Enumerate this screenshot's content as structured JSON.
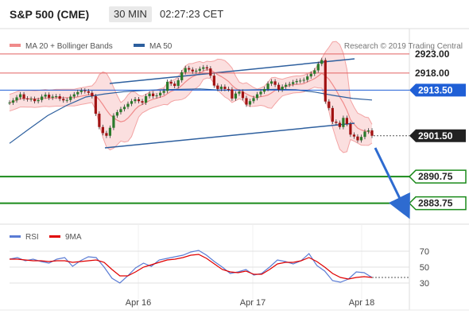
{
  "header": {
    "title": "S&P 500 (CME)",
    "timeframe": "30 MIN",
    "time": "02:27:23 CET"
  },
  "colors": {
    "accent_blue": "#1f5fd6",
    "target_green": "#1a8a1a",
    "resistance_red": "#e26060",
    "ma50": "#2d5f9e",
    "band": "#f3a4a4",
    "rsi": "#5a7bd4",
    "rsi_ma": "#e00000"
  },
  "chart_data": [
    {
      "type": "line",
      "title": "S&P 500 (CME) 30 MIN",
      "legend": [
        {
          "name": "MA 20 + Bollinger Bands"
        },
        {
          "name": "MA 50"
        }
      ],
      "watermark": "Research © 2019 Trading Central",
      "ylim": [
        2879.5,
        2928
      ],
      "x_ticks": [
        "Apr 16",
        "Apr 17",
        "Apr 18"
      ],
      "levels": [
        {
          "value": 2923.0,
          "label": "2923.00",
          "kind": "resistance"
        },
        {
          "value": 2918.0,
          "label": "2918.00",
          "kind": "resistance"
        },
        {
          "value": 2913.5,
          "label": "2913.50",
          "kind": "pivot"
        },
        {
          "value": 2901.5,
          "label": "2901.50",
          "kind": "last"
        },
        {
          "value": 2890.75,
          "label": "2890.75",
          "kind": "target"
        },
        {
          "value": 2883.75,
          "label": "2883.75",
          "kind": "target"
        }
      ],
      "series": [
        {
          "name": "Price",
          "values": [
            2910.2,
            2910.8,
            2911.6,
            2912.4,
            2911.3,
            2911.1,
            2911.2,
            2910.6,
            2910.9,
            2911.8,
            2912.3,
            2911.5,
            2911.8,
            2911.9,
            2911.2,
            2910.8,
            2910.9,
            2911.8,
            2912.4,
            2913.0,
            2913.4,
            2913.2,
            2912.8,
            2911.9,
            2907.3,
            2903.8,
            2902.2,
            2901.5,
            2903.6,
            2906.8,
            2907.7,
            2908.5,
            2909.1,
            2909.9,
            2910.6,
            2911.1,
            2910.6,
            2910.2,
            2911.9,
            2912.6,
            2911.9,
            2912.1,
            2912.8,
            2913.3,
            2915.7,
            2915.2,
            2914.6,
            2916.1,
            2918.2,
            2919.3,
            2918.9,
            2918.4,
            2918.6,
            2919.1,
            2919.5,
            2919.2,
            2917.3,
            2914.7,
            2913.8,
            2914.4,
            2913.8,
            2913.7,
            2911.3,
            2912.6,
            2913.1,
            2911.4,
            2909.7,
            2910.6,
            2911.4,
            2912.4,
            2913.1,
            2913.8,
            2915.2,
            2915.8,
            2914.9,
            2913.6,
            2914.4,
            2914.9,
            2915.1,
            2915.6,
            2915.9,
            2916.0,
            2916.2,
            2917.1,
            2917.8,
            2918.7,
            2920.4,
            2921.4,
            2910.5,
            2908.8,
            2905.2,
            2904.9,
            2903.8,
            2906.2,
            2904.6,
            2901.8,
            2901.3,
            2900.3,
            2901.2,
            2902.6,
            2902.9,
            2901.5
          ]
        },
        {
          "name": "MA 50",
          "values": [
            2899.5,
            2903.2,
            2906.8,
            2909.5,
            2911.7,
            2912.5,
            2913.1,
            2913.4,
            2913.6,
            2913.7,
            2913.8,
            2913.5,
            2913.5,
            2913.6,
            2913.7,
            2913.6,
            2913.0,
            2912.1,
            2911.3,
            2910.9
          ]
        },
        {
          "name": "RSI",
          "values": [
            60,
            62,
            58,
            60,
            57,
            55,
            60,
            62,
            51,
            58,
            63,
            62,
            50,
            36,
            30,
            39,
            49,
            55,
            51,
            59,
            61,
            63,
            65,
            69,
            71,
            65,
            57,
            50,
            42,
            44,
            47,
            40,
            42,
            50,
            59,
            57,
            54,
            58,
            67,
            52,
            45,
            33,
            31,
            35,
            44,
            43,
            37
          ]
        },
        {
          "name": "9MA",
          "values": [
            60,
            60,
            59,
            58,
            58,
            57,
            58,
            58,
            56,
            57,
            58,
            59,
            56,
            47,
            39,
            39,
            44,
            50,
            53,
            56,
            59,
            60,
            62,
            65,
            66,
            61,
            54,
            47,
            44,
            43,
            45,
            41,
            41,
            47,
            54,
            56,
            56,
            58,
            62,
            57,
            50,
            42,
            37,
            35,
            37,
            38,
            37
          ]
        }
      ],
      "rsi_ylim": [
        20,
        80
      ],
      "rsi_ticks": [
        70,
        50,
        30
      ],
      "rsi_legend": [
        {
          "name": "RSI"
        },
        {
          "name": "9MA"
        }
      ]
    }
  ]
}
